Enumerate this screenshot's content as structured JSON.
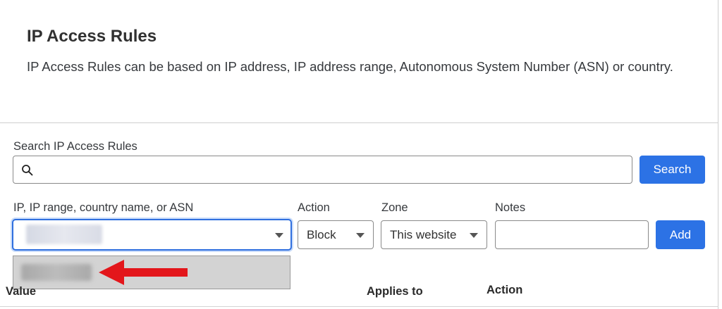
{
  "header": {
    "title": "IP Access Rules",
    "description": "IP Access Rules can be based on IP address, IP address range, Autonomous System Number (ASN) or country."
  },
  "search": {
    "label": "Search IP Access Rules",
    "placeholder": "",
    "value": "",
    "button_label": "Search"
  },
  "form": {
    "ip_label": "IP, IP range, country name, or ASN",
    "ip_value_redacted": true,
    "action_label": "Action",
    "action_value": "Block",
    "zone_label": "Zone",
    "zone_value": "This website",
    "notes_label": "Notes",
    "notes_value": "",
    "add_label": "Add"
  },
  "autocomplete": {
    "suggestion_redacted": true
  },
  "table": {
    "columns": [
      "Value",
      "Applies to",
      "Action"
    ]
  },
  "colors": {
    "primary": "#2c72e5",
    "annotation_arrow": "#e3161b",
    "focus_border": "#2f6fdf"
  },
  "icons": {
    "search": "search-icon",
    "dropdown": "chevron-down-icon",
    "annotation": "arrow-left-icon"
  }
}
